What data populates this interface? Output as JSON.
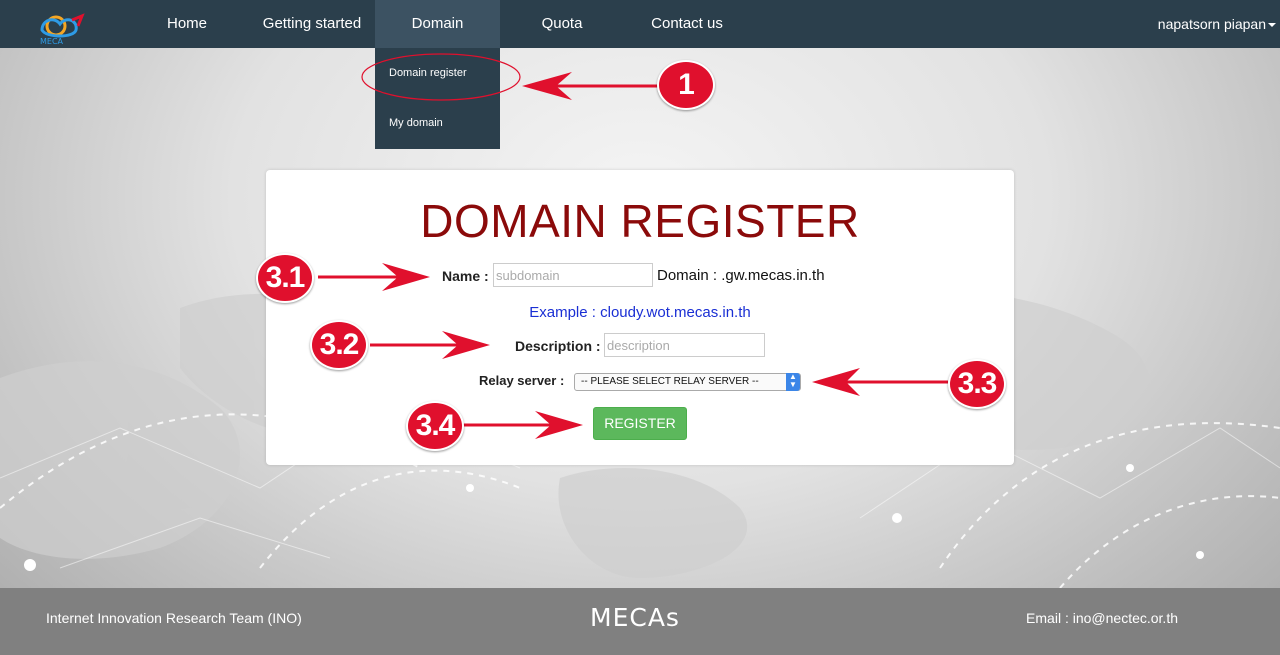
{
  "nav": {
    "items": [
      {
        "label": "Home"
      },
      {
        "label": "Getting started"
      },
      {
        "label": "Domain"
      },
      {
        "label": "Quota"
      },
      {
        "label": "Contact us"
      }
    ],
    "user": "napatsorn piapan",
    "logo_text": "MECAs"
  },
  "dropdown": {
    "items": [
      {
        "label": "Domain register"
      },
      {
        "label": "My domain"
      }
    ]
  },
  "form": {
    "title": "DOMAIN REGISTER",
    "name_label": "Name :",
    "name_placeholder": "subdomain",
    "name_value": "",
    "domain_suffix": "Domain : .gw.mecas.in.th",
    "example": "Example : cloudy.wot.mecas.in.th",
    "description_label": "Description :",
    "description_placeholder": "description",
    "description_value": "",
    "relay_label": "Relay server :",
    "relay_selected": "-- PLEASE SELECT RELAY SERVER --",
    "register_label": "REGISTER"
  },
  "annotations": {
    "steps": [
      "1",
      "3.1",
      "3.2",
      "3.3",
      "3.4"
    ]
  },
  "footer": {
    "left": "Internet Innovation Research Team (INO)",
    "brand": "MECAs",
    "email": "Email : ino@nectec.or.th"
  },
  "colors": {
    "navbar": "#2b3f4c",
    "title": "#8b0a0a",
    "example_link": "#1a2fd4",
    "register_button": "#5cb85c",
    "annotation_red": "#e0102d",
    "footer": "#808080"
  }
}
